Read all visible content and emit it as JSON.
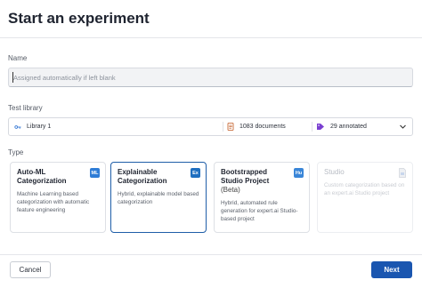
{
  "dialog": {
    "title": "Start an experiment"
  },
  "name_field": {
    "label": "Name",
    "placeholder": "Assigned automatically if left blank",
    "value": ""
  },
  "library_field": {
    "label": "Test library",
    "library_name": "Library 1",
    "documents": "1083 documents",
    "annotated": "29 annotated",
    "icons": {
      "library": "library-icon",
      "documents": "document-icon",
      "annotated": "tag-icon",
      "expand": "chevron-down-icon"
    }
  },
  "type_field": {
    "label": "Type",
    "options": [
      {
        "title": "Auto-ML Categorization",
        "badge": "ML",
        "description": "Machine Learning based categorization with automatic feature engineering",
        "selected": false,
        "disabled": false
      },
      {
        "title": "Explainable Categorization",
        "badge": "Ex",
        "description": "Hybrid, explainable model based categorization",
        "selected": true,
        "disabled": false
      },
      {
        "title": "Bootstrapped Studio Project",
        "title_suffix": "(Beta)",
        "badge": "Hu",
        "description": "Hybrid, automated rule generation for expert.ai Studio-based project",
        "selected": false,
        "disabled": false
      },
      {
        "title": "Studio",
        "badge": "studio-file-icon",
        "description": "Custom categorization based on an expert.ai Studio project",
        "selected": false,
        "disabled": true
      }
    ]
  },
  "footer": {
    "cancel_label": "Cancel",
    "next_label": "Next"
  },
  "colors": {
    "primary": "#1a56b0",
    "selected_border": "#1f5ea8",
    "badge": "#2e7cd6",
    "annotated_tag": "#7a3fd1"
  }
}
